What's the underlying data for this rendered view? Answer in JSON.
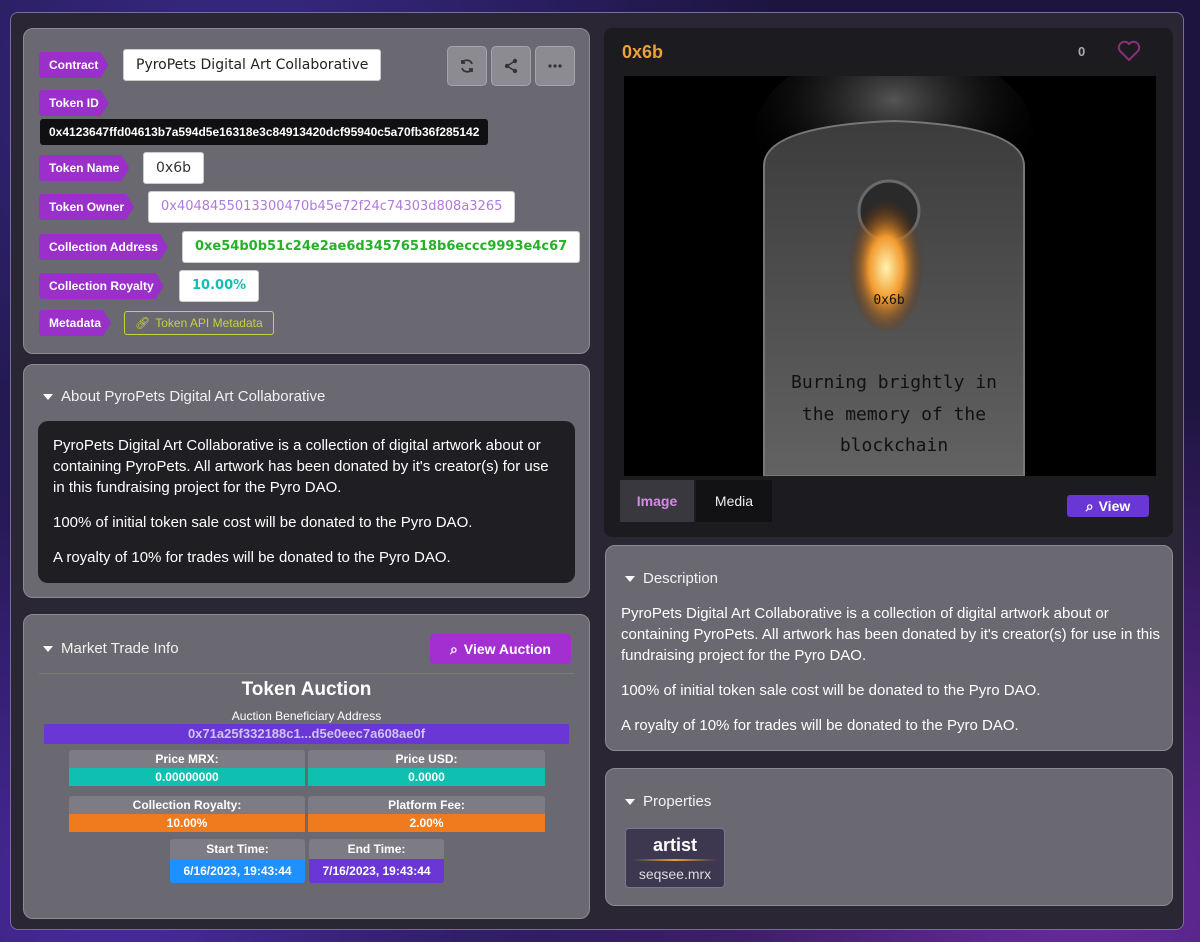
{
  "token_card": {
    "contract_label": "Contract",
    "contract_value": "PyroPets Digital Art Collaborative",
    "token_id_label": "Token ID",
    "token_id_value": "0x4123647ffd04613b7a594d5e16318e3c84913420dcf95940c5a70fb36f285142",
    "token_name_label": "Token Name",
    "token_name_value": "0x6b",
    "token_owner_label": "Token Owner",
    "token_owner_value": "0x4048455013300470b45e72f24c74303d808a3265",
    "collection_address_label": "Collection Address",
    "collection_address_value": "0xe54b0b51c24e2ae6d34576518b6eccc9993e4c67",
    "collection_royalty_label": "Collection Royalty",
    "collection_royalty_value": "10.00%",
    "metadata_label": "Metadata",
    "metadata_link": "Token API Metadata",
    "buttons": [
      "refresh-icon",
      "share-icon",
      "more-icon"
    ]
  },
  "about": {
    "title": "About PyroPets Digital Art Collaborative",
    "p1": "PyroPets Digital Art Collaborative is a collection of digital artwork about or containing PyroPets. All artwork has been donated by it's creator(s) for use in this fundraising project for the Pyro DAO.",
    "p2": "100% of initial token sale cost will be donated to the Pyro DAO.",
    "p3": "A royalty of 10% for trades will be donated to the Pyro DAO."
  },
  "market": {
    "title": "Market Trade Info",
    "view_auction": "View Auction",
    "auction_title": "Token Auction",
    "beneficiary_label": "Auction Beneficiary Address",
    "beneficiary_value": "0x71a25f332188c1...d5e0eec7a608ae0f",
    "price_mrx_label": "Price MRX:",
    "price_mrx_value": "0.00000000",
    "price_usd_label": "Price USD:",
    "price_usd_value": "0.0000",
    "royalty_label": "Collection Royalty:",
    "royalty_value": "10.00%",
    "platform_fee_label": "Platform Fee:",
    "platform_fee_value": "2.00%",
    "start_label": "Start Time:",
    "start_value": "6/16/2023, 19:43:44",
    "end_label": "End Time:",
    "end_value": "7/16/2023, 19:43:44"
  },
  "media": {
    "title": "0x6b",
    "likes": "0",
    "art_number": "0x6b",
    "art_lines": [
      "Burning brightly in",
      "the memory of the",
      "blockchain"
    ],
    "tab_image": "Image",
    "tab_media": "Media",
    "view": "View"
  },
  "description": {
    "title": "Description",
    "p1": "PyroPets Digital Art Collaborative is a collection of digital artwork about or containing PyroPets. All artwork has been donated by it's creator(s) for use in this fundraising project for the Pyro DAO.",
    "p2": "100% of initial token sale cost will be donated to the Pyro DAO.",
    "p3": "A royalty of 10% for trades will be donated to the Pyro DAO."
  },
  "properties": {
    "title": "Properties",
    "items": [
      {
        "key": "artist",
        "value": "seqsee.mrx"
      }
    ]
  },
  "colors": {
    "purple": "#9a2fc9",
    "teal": "#0fbfb0",
    "orange": "#f07a1e",
    "blue": "#1e90ff",
    "violet": "#6a36d6",
    "gold": "#e8a23a"
  }
}
